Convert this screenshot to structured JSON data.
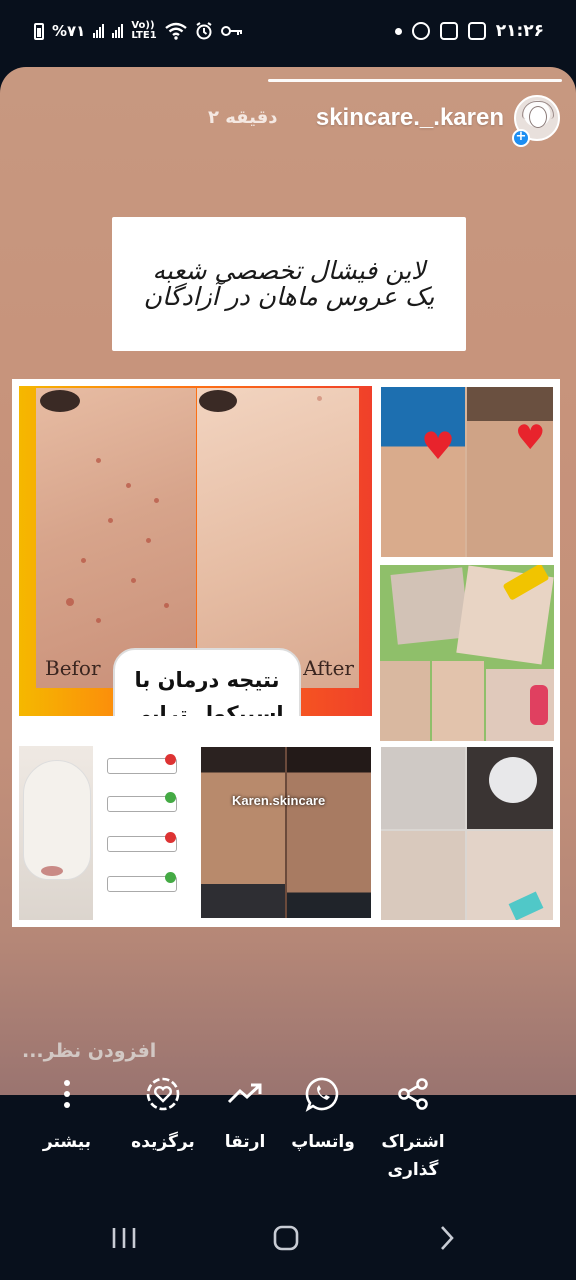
{
  "status_bar": {
    "battery_percent": "%۷۱",
    "network": "Vo)) LTE1",
    "time": "۲۱:۲۶"
  },
  "story": {
    "username": "skincare._.karen",
    "posted_ago": "۲ دقیقه",
    "title_text": "لاین فیشال تخصصی شعبه یک عروس ماهان در آزادگان",
    "before_label": "Befor",
    "after_label": "After",
    "result_line1": "نتیجه درمان با",
    "result_line2": "اسپیکول تراپی",
    "watermark": "Karen.skincare",
    "comment_placeholder": "افزودن نظر..."
  },
  "actions": [
    {
      "label": "اشتراک\nگذاری",
      "icon": "share-icon"
    },
    {
      "label": "واتساپ",
      "icon": "whatsapp-icon"
    },
    {
      "label": "ارتقا",
      "icon": "trending-up-icon"
    },
    {
      "label": "برگزیده",
      "icon": "favorite-heart-icon"
    },
    {
      "label": "بیشتر",
      "icon": "more-vertical-icon"
    }
  ],
  "colors": {
    "story_bg": "#c7937b",
    "accent_blue": "#1d8ef2",
    "heart_red": "#e8232c"
  }
}
